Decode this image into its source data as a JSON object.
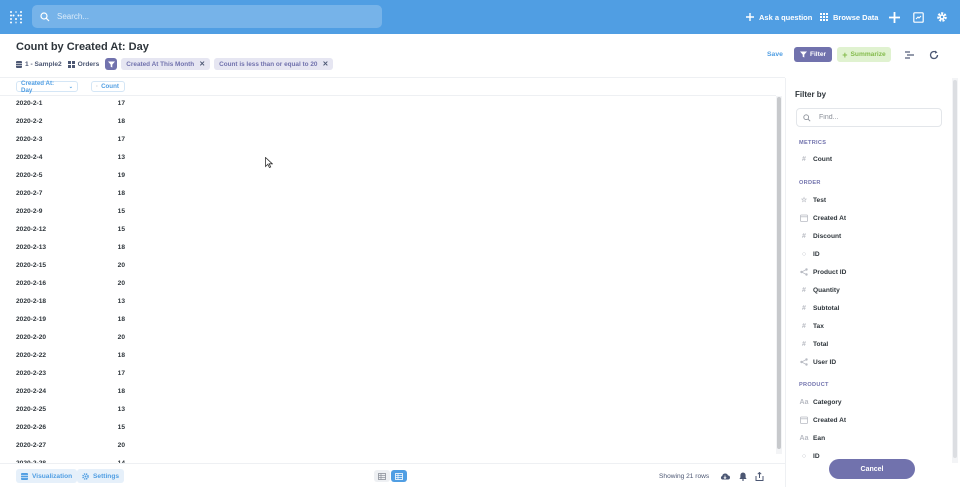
{
  "topbar": {
    "search_placeholder": "Search...",
    "ask_label": "Ask a question",
    "browse_label": "Browse Data",
    "accent": "#509ee3"
  },
  "header": {
    "title": "Count by Created At: Day",
    "database": "1 - Sample2",
    "table": "Orders",
    "filters": [
      "Created At This Month",
      "Count is less than or equal to 20"
    ],
    "save_label": "Save",
    "filter_label": "Filter",
    "summarize_label": "Summarize"
  },
  "table": {
    "columns": [
      "Created At: Day",
      "Count"
    ],
    "rows": [
      [
        "2020-2-1",
        "17"
      ],
      [
        "2020-2-2",
        "18"
      ],
      [
        "2020-2-3",
        "17"
      ],
      [
        "2020-2-4",
        "13"
      ],
      [
        "2020-2-5",
        "19"
      ],
      [
        "2020-2-7",
        "18"
      ],
      [
        "2020-2-9",
        "15"
      ],
      [
        "2020-2-12",
        "15"
      ],
      [
        "2020-2-13",
        "18"
      ],
      [
        "2020-2-15",
        "20"
      ],
      [
        "2020-2-16",
        "20"
      ],
      [
        "2020-2-18",
        "13"
      ],
      [
        "2020-2-19",
        "18"
      ],
      [
        "2020-2-20",
        "20"
      ],
      [
        "2020-2-22",
        "18"
      ],
      [
        "2020-2-23",
        "17"
      ],
      [
        "2020-2-24",
        "18"
      ],
      [
        "2020-2-25",
        "13"
      ],
      [
        "2020-2-26",
        "15"
      ],
      [
        "2020-2-27",
        "20"
      ],
      [
        "2020-2-28",
        "14"
      ]
    ]
  },
  "footer": {
    "visualization_label": "Visualization",
    "settings_label": "Settings",
    "rows_label": "Showing 21 rows"
  },
  "sidebar": {
    "title": "Filter by",
    "search_placeholder": "Find...",
    "sections": [
      {
        "label": "METRICS",
        "fields": [
          {
            "label": "Count",
            "icon": "hash-icon"
          }
        ]
      },
      {
        "label": "ORDER",
        "fields": [
          {
            "label": "Test",
            "icon": "star-icon"
          },
          {
            "label": "Created At",
            "icon": "calendar-icon"
          },
          {
            "label": "Discount",
            "icon": "hash-icon"
          },
          {
            "label": "ID",
            "icon": "id-icon"
          },
          {
            "label": "Product ID",
            "icon": "connection-icon"
          },
          {
            "label": "Quantity",
            "icon": "hash-icon"
          },
          {
            "label": "Subtotal",
            "icon": "hash-icon"
          },
          {
            "label": "Tax",
            "icon": "hash-icon"
          },
          {
            "label": "Total",
            "icon": "hash-icon"
          },
          {
            "label": "User ID",
            "icon": "connection-icon"
          }
        ]
      },
      {
        "label": "PRODUCT",
        "fields": [
          {
            "label": "Category",
            "icon": "text-icon"
          },
          {
            "label": "Created At",
            "icon": "calendar-icon"
          },
          {
            "label": "Ean",
            "icon": "text-icon"
          },
          {
            "label": "ID",
            "icon": "id-icon"
          }
        ]
      }
    ],
    "cancel_label": "Cancel",
    "accent": "#7172ad"
  }
}
